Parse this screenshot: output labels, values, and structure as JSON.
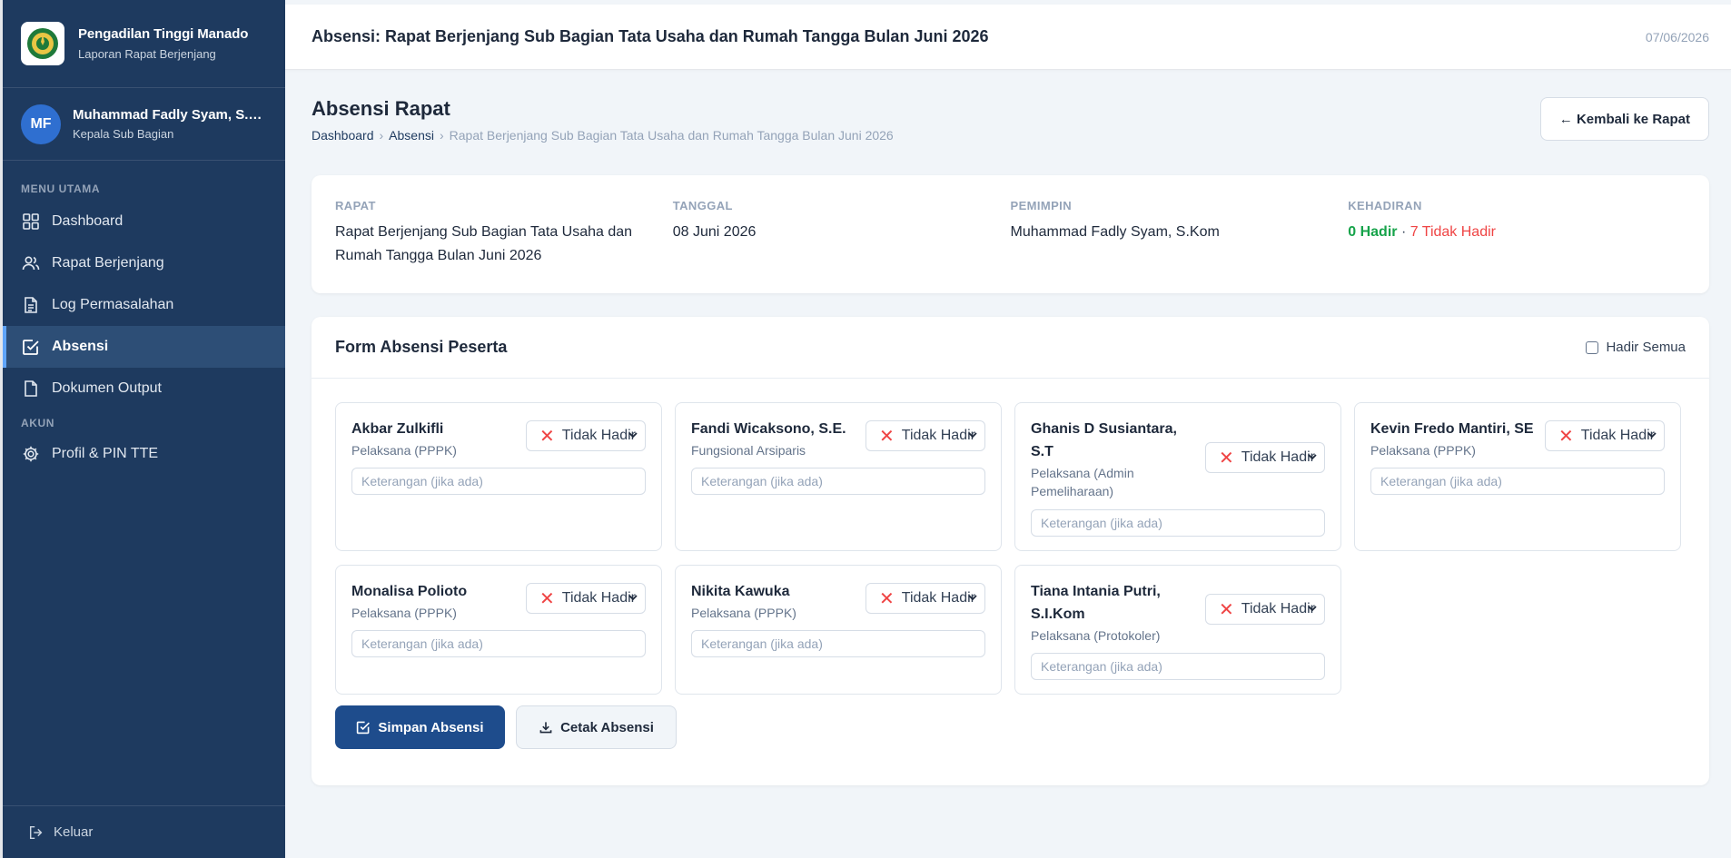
{
  "sidebar": {
    "brand_title": "Pengadilan Tinggi Manado",
    "brand_sub": "Laporan Rapat Berjenjang",
    "user_initials": "MF",
    "user_name": "Muhammad Fadly Syam, S.Kom",
    "user_role": "Kepala Sub Bagian",
    "menu_label": "MENU UTAMA",
    "account_label": "AKUN",
    "items": [
      {
        "label": "Dashboard",
        "icon": "grid-icon"
      },
      {
        "label": "Rapat Berjenjang",
        "icon": "users-icon"
      },
      {
        "label": "Log Permasalahan",
        "icon": "document-icon"
      },
      {
        "label": "Absensi",
        "icon": "checkbox-icon"
      },
      {
        "label": "Dokumen Output",
        "icon": "file-icon"
      }
    ],
    "account_items": [
      {
        "label": "Profil & PIN TTE",
        "icon": "gear-icon"
      }
    ],
    "logout_label": "Keluar"
  },
  "topbar": {
    "title": "Absensi: Rapat Berjenjang Sub Bagian Tata Usaha dan Rumah Tangga Bulan Juni 2026",
    "date": "07/06/2026"
  },
  "page": {
    "title": "Absensi Rapat",
    "breadcrumb": [
      "Dashboard",
      "Absensi",
      "Rapat Berjenjang Sub Bagian Tata Usaha dan Rumah Tangga Bulan Juni 2026"
    ],
    "back_label": "← Kembali ke Rapat"
  },
  "info": {
    "rapat_label": "RAPAT",
    "rapat_value": "Rapat Berjenjang Sub Bagian Tata Usaha dan Rumah Tangga Bulan Juni 2026",
    "tanggal_label": "TANGGAL",
    "tanggal_value": "08 Juni 2026",
    "pemimpin_label": "PEMIMPIN",
    "pemimpin_value": "Muhammad Fadly Syam, S.Kom",
    "kehadiran_label": "KEHADIRAN",
    "hadir": "0 Hadir",
    "separator": " · ",
    "tidak_hadir": "7 Tidak Hadir"
  },
  "form": {
    "title": "Form Absensi Peserta",
    "check_all_label": "Hadir Semua",
    "status_label": "Tidak Hadir",
    "note_placeholder": "Keterangan (jika ada)",
    "participants": [
      {
        "name": "Akbar Zulkifli",
        "role": "Pelaksana (PPPK)"
      },
      {
        "name": "Fandi Wicaksono, S.E.",
        "role": "Fungsional Arsiparis"
      },
      {
        "name": "Ghanis D Susiantara, S.T",
        "role": "Pelaksana (Admin Pemeliharaan)"
      },
      {
        "name": "Kevin Fredo Mantiri, SE",
        "role": "Pelaksana (PPPK)"
      },
      {
        "name": "Monalisa Polioto",
        "role": "Pelaksana (PPPK)"
      },
      {
        "name": "Nikita Kawuka",
        "role": "Pelaksana (PPPK)"
      },
      {
        "name": "Tiana Intania Putri, S.I.Kom",
        "role": "Pelaksana (Protokoler)"
      }
    ],
    "save_label": "Simpan Absensi",
    "print_label": "Cetak Absensi"
  },
  "colors": {
    "sidebar_bg": "#1e3a5f",
    "primary": "#1e4c8c",
    "present": "#16a34a",
    "absent": "#ef4444"
  }
}
